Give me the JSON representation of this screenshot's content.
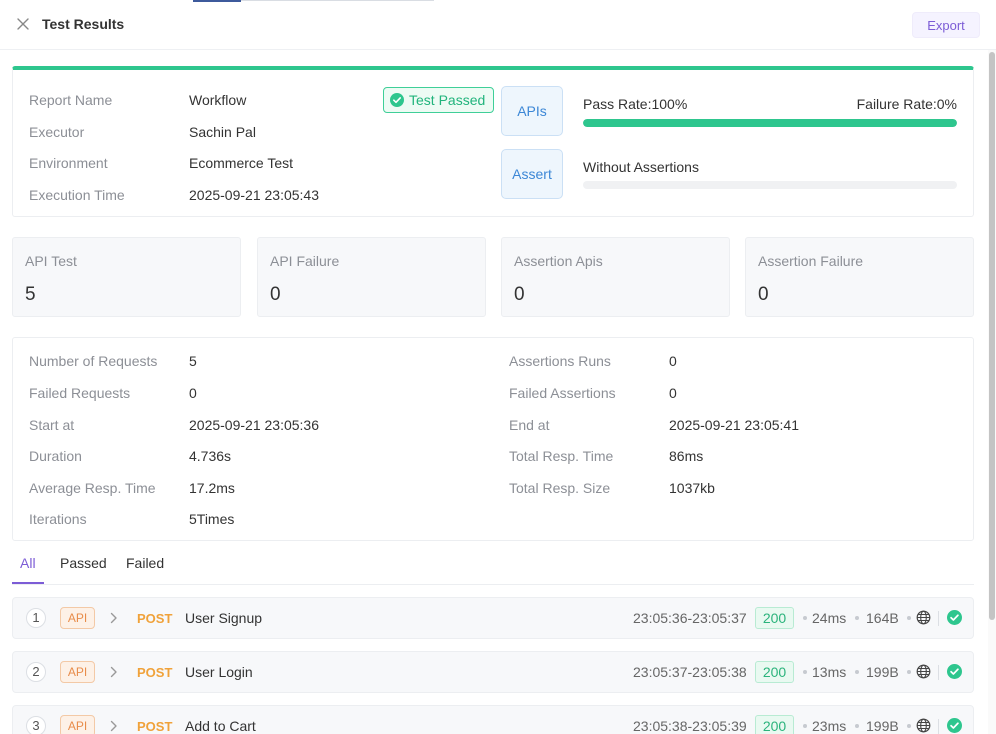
{
  "header": {
    "title": "Test Results",
    "export_label": "Export"
  },
  "summary": {
    "rows": [
      {
        "label": "Report Name",
        "value": "Workflow"
      },
      {
        "label": "Executor",
        "value": "Sachin Pal"
      },
      {
        "label": "Environment",
        "value": "Ecommerce Test"
      },
      {
        "label": "Execution Time",
        "value": "2025-09-21 23:05:43"
      }
    ],
    "status_badge": "Test Passed",
    "apis_label": "APIs",
    "assert_label": "Assert",
    "pass_rate": "Pass Rate:100%",
    "failure_rate": "Failure Rate:0%",
    "pass_fraction": 1.0,
    "assertions_text": "Without Assertions",
    "assertions_fraction": 0
  },
  "stats": [
    {
      "label": "API Test",
      "value": "5"
    },
    {
      "label": "API Failure",
      "value": "0"
    },
    {
      "label": "Assertion Apis",
      "value": "0"
    },
    {
      "label": "Assertion Failure",
      "value": "0"
    }
  ],
  "details": {
    "left": [
      {
        "label": "Number of Requests",
        "value": "5"
      },
      {
        "label": "Failed Requests",
        "value": "0"
      },
      {
        "label": "Start at",
        "value": "2025-09-21 23:05:36"
      },
      {
        "label": "Duration",
        "value": "4.736s"
      },
      {
        "label": "Average Resp. Time",
        "value": "17.2ms"
      },
      {
        "label": "Iterations",
        "value": "5Times"
      }
    ],
    "right": [
      {
        "label": "Assertions Runs",
        "value": "0"
      },
      {
        "label": "Failed Assertions",
        "value": "0"
      },
      {
        "label": "End at",
        "value": "2025-09-21 23:05:41"
      },
      {
        "label": "Total Resp. Time",
        "value": "86ms"
      },
      {
        "label": "Total Resp. Size",
        "value": "1037kb"
      }
    ]
  },
  "filters": {
    "all": "All",
    "passed": "Passed",
    "failed": "Failed"
  },
  "requests": [
    {
      "index": "1",
      "type": "API",
      "method": "POST",
      "name": "User Signup",
      "time": "23:05:36-23:05:37",
      "status": "200",
      "duration": "24ms",
      "size": "164B"
    },
    {
      "index": "2",
      "type": "API",
      "method": "POST",
      "name": "User Login",
      "time": "23:05:37-23:05:38",
      "status": "200",
      "duration": "13ms",
      "size": "199B"
    },
    {
      "index": "3",
      "type": "API",
      "method": "POST",
      "name": "Add to Cart",
      "time": "23:05:38-23:05:39",
      "status": "200",
      "duration": "23ms",
      "size": "199B"
    }
  ],
  "colors": {
    "success": "#2ec68e",
    "accent": "#7c5cd6",
    "method_post": "#f0a23a",
    "info": "#3c87d6"
  }
}
